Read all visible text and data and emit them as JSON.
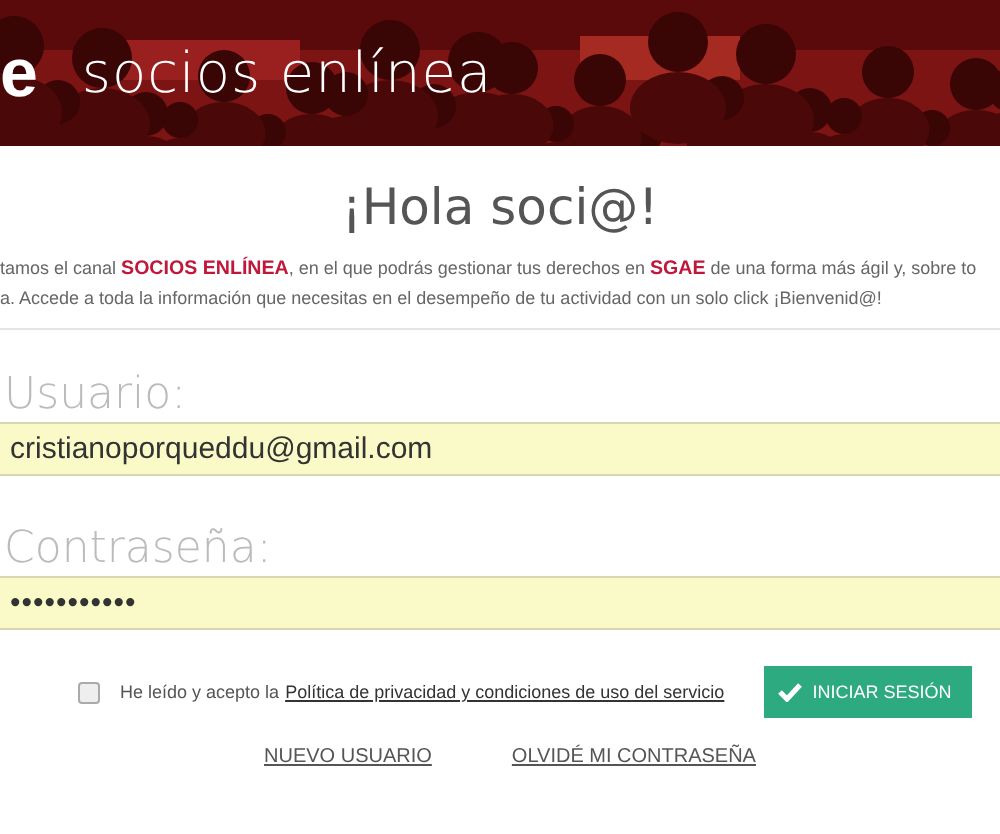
{
  "header": {
    "logo_fragment": "e",
    "site_name": "socios enlínea"
  },
  "greeting": "¡Hola soci@!",
  "intro": [
    "tamos el canal **SOCIOS ENLÍNEA**, en el que podrás gestionar tus derechos en **SGAE** de una forma más ágil y, sobre to",
    "a. Accede a toda la información que necesitas en el desempeño de tu actividad con un solo click ¡Bienvenid@!"
  ],
  "fields": [
    {
      "label": "Usuario:",
      "value": "cristianoporqueddu@gmail.com",
      "kind": "text"
    },
    {
      "label": "Contraseña:",
      "value": "•••••••••••",
      "kind": "password"
    }
  ],
  "consent": {
    "checked": false,
    "text": "He leído y acepto la",
    "link": "Política de privacidad y condiciones de uso del servicio"
  },
  "login_button": "INICIAR SESIÓN",
  "links": [
    "NUEVO USUARIO",
    "OLVIDÉ MI CONTRASEÑA"
  ]
}
